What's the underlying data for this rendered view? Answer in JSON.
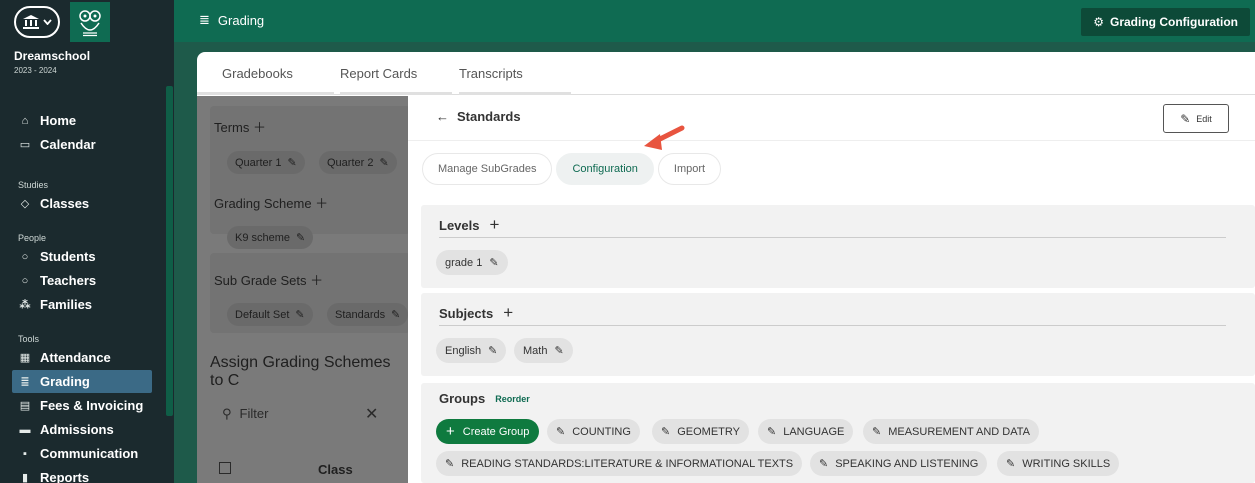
{
  "sidebar": {
    "school": "Dreamschool",
    "year": "2023 - 2024",
    "sections": {
      "studies": "Studies",
      "people": "People",
      "tools": "Tools"
    },
    "items": [
      {
        "label": "Home",
        "icon": "home-icon"
      },
      {
        "label": "Calendar",
        "icon": "calendar-icon"
      },
      {
        "label": "Classes",
        "icon": "graduation-cap-icon"
      },
      {
        "label": "Students",
        "icon": "user-icon"
      },
      {
        "label": "Teachers",
        "icon": "teacher-icon"
      },
      {
        "label": "Families",
        "icon": "family-icon"
      },
      {
        "label": "Attendance",
        "icon": "attendance-icon"
      },
      {
        "label": "Grading",
        "icon": "grading-icon",
        "active": true
      },
      {
        "label": "Fees & Invoicing",
        "icon": "invoice-icon"
      },
      {
        "label": "Admissions",
        "icon": "admissions-icon"
      },
      {
        "label": "Communication",
        "icon": "chat-icon"
      },
      {
        "label": "Reports",
        "icon": "reports-icon"
      }
    ]
  },
  "topbar": {
    "title": "Grading",
    "config_button": "Grading Configuration"
  },
  "tabs": [
    "Gradebooks",
    "Report Cards",
    "Transcripts"
  ],
  "background": {
    "terms_title": "Terms",
    "terms": [
      "Quarter 1",
      "Quarter 2"
    ],
    "scheme_title": "Grading Scheme",
    "schemes": [
      "K9 scheme"
    ],
    "subgrade_title": "Sub Grade Sets",
    "subgrades": [
      "Default Set",
      "Standards"
    ],
    "assign_text": "Assign Grading Schemes to C",
    "filter_placeholder": "Filter",
    "class_header": "Class"
  },
  "standards": {
    "title": "Standards",
    "edit_label": "Edit",
    "subtabs": [
      "Manage SubGrades",
      "Configuration",
      "Import"
    ],
    "levels": {
      "title": "Levels",
      "items": [
        "grade 1"
      ]
    },
    "subjects": {
      "title": "Subjects",
      "items": [
        "English",
        "Math"
      ]
    },
    "groups": {
      "title": "Groups",
      "reorder": "Reorder",
      "create": "Create Group",
      "row1": [
        "COUNTING",
        "GEOMETRY",
        "LANGUAGE",
        "MEASUREMENT AND DATA"
      ],
      "row2": [
        "READING STANDARDS:LITERATURE & INFORMATIONAL TEXTS",
        "SPEAKING AND LISTENING",
        "WRITING SKILLS"
      ]
    }
  },
  "colors": {
    "brand": "#0f6b52",
    "sidebar": "#1b2a2e",
    "active": "#3b6a86",
    "arrow": "#e8543f"
  }
}
